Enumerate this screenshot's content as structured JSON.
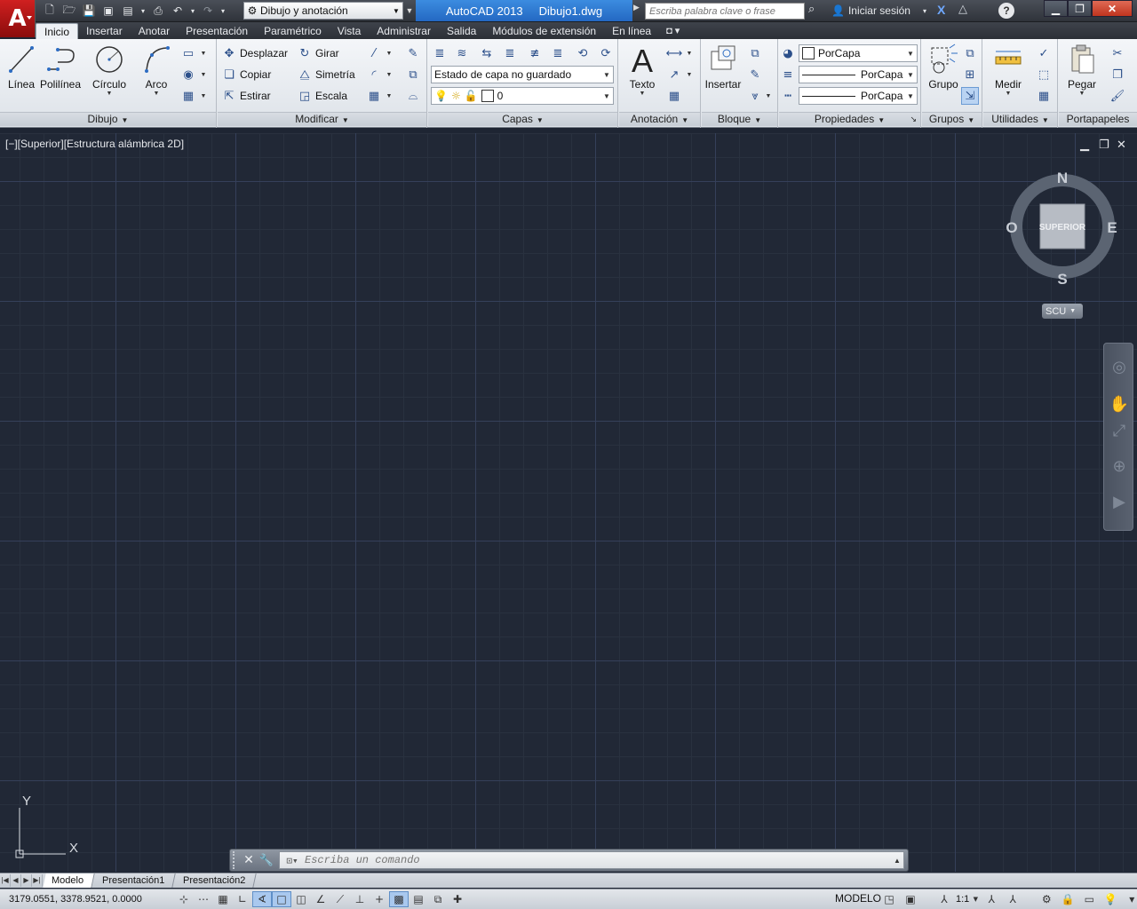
{
  "titlebar": {
    "app_letter": "A",
    "workspace": "Dibujo y anotación",
    "app_name": "AutoCAD 2013",
    "doc_name": "Dibujo1.dwg",
    "search_placeholder": "Escriba palabra clave o frase",
    "login": "Iniciar sesión",
    "help": "?"
  },
  "tabs": [
    "Inicio",
    "Insertar",
    "Anotar",
    "Presentación",
    "Paramétrico",
    "Vista",
    "Administrar",
    "Salida",
    "Módulos de extensión",
    "En línea"
  ],
  "ribbon": {
    "dibujo": {
      "title": "Dibujo",
      "linea": "Línea",
      "polilinea": "Polilínea",
      "circulo": "Círculo",
      "arco": "Arco"
    },
    "modificar": {
      "title": "Modificar",
      "desplazar": "Desplazar",
      "girar": "Girar",
      "copiar": "Copiar",
      "simetria": "Simetría",
      "estirar": "Estirar",
      "escala": "Escala"
    },
    "capas": {
      "title": "Capas",
      "layer_state": "Estado de capa no guardado",
      "current_layer": "0"
    },
    "anotacion": {
      "title": "Anotación",
      "texto": "Texto"
    },
    "bloque": {
      "title": "Bloque",
      "insertar": "Insertar"
    },
    "propiedades": {
      "title": "Propiedades",
      "color": "PorCapa",
      "linetype": "PorCapa",
      "lineweight": "PorCapa"
    },
    "grupos": {
      "title": "Grupos",
      "grupo": "Grupo"
    },
    "utilidades": {
      "title": "Utilidades",
      "medir": "Medir"
    },
    "portapapeles": {
      "title": "Portapapeles",
      "pegar": "Pegar"
    }
  },
  "viewport": {
    "label": "[−][Superior][Estructura alámbrica 2D]",
    "viewcube": {
      "face": "SUPERIOR",
      "n": "N",
      "s": "S",
      "e": "E",
      "w": "O"
    },
    "ucs_menu": "SCU",
    "ucs_x": "X",
    "ucs_y": "Y"
  },
  "command": {
    "placeholder": "Escriba un comando"
  },
  "layout_tabs": [
    "Modelo",
    "Presentación1",
    "Presentación2"
  ],
  "status": {
    "coords": "3179.0551, 3378.9521, 0.0000",
    "space": "MODELO",
    "scale": "1:1"
  },
  "colors": {
    "canvas": "#212836",
    "grid_major": "#35405a",
    "title_highlight": "#2f7ad6",
    "app_red": "#c81818"
  }
}
